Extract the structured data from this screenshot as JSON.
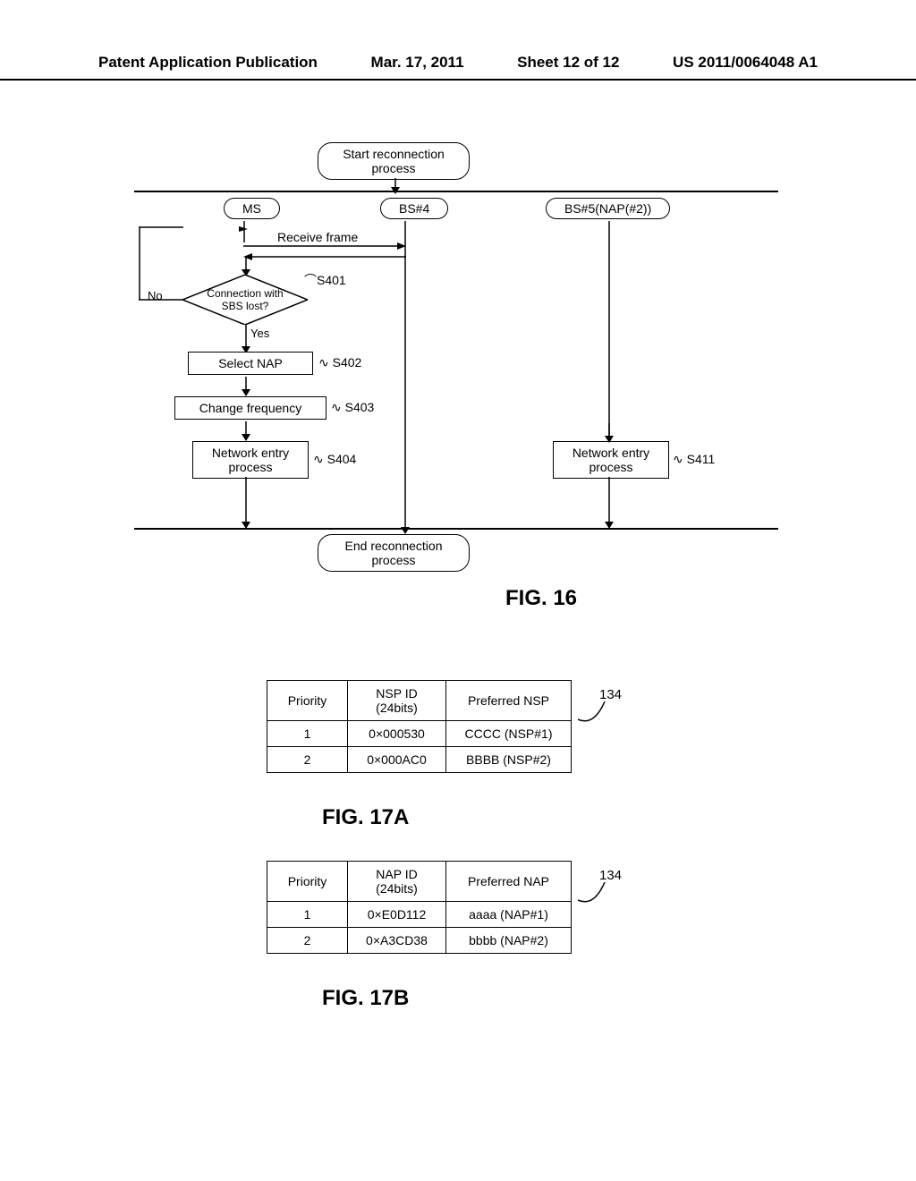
{
  "header": {
    "left": "Patent Application Publication",
    "date": "Mar. 17, 2011",
    "sheet": "Sheet 12 of 12",
    "pubno": "US 2011/0064048 A1"
  },
  "fig16": {
    "start": "Start reconnection process",
    "end": "End reconnection process",
    "lanes": {
      "ms": "MS",
      "bs4": "BS#4",
      "bs5": "BS#5(NAP(#2))"
    },
    "receive_frame": "Receive frame",
    "decision": "Connection with SBS lost?",
    "no": "No",
    "yes": "Yes",
    "select_nap": "Select NAP",
    "change_freq": "Change frequency",
    "net_entry": "Network entry process",
    "s401": "S401",
    "s402": "S402",
    "s403": "S403",
    "s404": "S404",
    "s411": "S411",
    "fig_label": "FIG. 16"
  },
  "fig17a": {
    "headers": [
      "Priority",
      "NSP ID (24bits)",
      "Preferred NSP"
    ],
    "rows": [
      {
        "priority": "1",
        "id": "0×000530",
        "name": "CCCC (NSP#1)"
      },
      {
        "priority": "2",
        "id": "0×000AC0",
        "name": "BBBB (NSP#2)"
      }
    ],
    "ref": "134",
    "fig_label": "FIG. 17A"
  },
  "fig17b": {
    "headers": [
      "Priority",
      "NAP ID (24bits)",
      "Preferred NAP"
    ],
    "rows": [
      {
        "priority": "1",
        "id": "0×E0D112",
        "name": "aaaa (NAP#1)"
      },
      {
        "priority": "2",
        "id": "0×A3CD38",
        "name": "bbbb (NAP#2)"
      }
    ],
    "ref": "134",
    "fig_label": "FIG. 17B"
  }
}
